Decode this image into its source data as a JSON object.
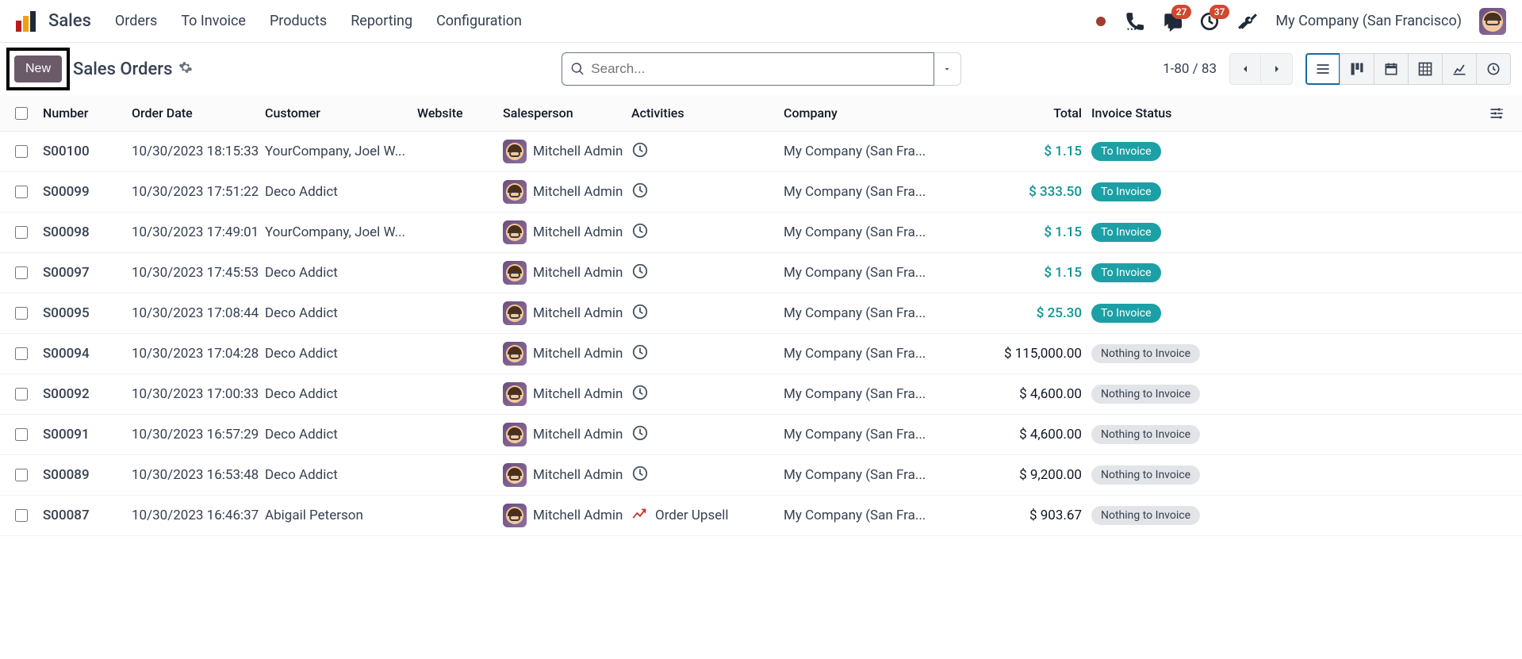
{
  "topbar": {
    "app_name": "Sales",
    "menu": [
      "Orders",
      "To Invoice",
      "Products",
      "Reporting",
      "Configuration"
    ],
    "chat_badge": "27",
    "activity_badge": "37",
    "company": "My Company (San Francisco)"
  },
  "controlbar": {
    "new_label": "New",
    "breadcrumb": "Sales Orders",
    "search_placeholder": "Search...",
    "pager_label": "1-80 / 83"
  },
  "table": {
    "columns": {
      "number": "Number",
      "order_date": "Order Date",
      "customer": "Customer",
      "website": "Website",
      "salesperson": "Salesperson",
      "activities": "Activities",
      "company": "Company",
      "total": "Total",
      "invoice_status": "Invoice Status"
    },
    "rows": [
      {
        "number": "S00100",
        "date": "10/30/2023 18:15:33",
        "customer": "YourCompany, Joel W...",
        "salesperson": "Mitchell Admin",
        "activity": "clock",
        "company": "My Company (San Fra...",
        "total": "$ 1.15",
        "total_style": "teal",
        "status": "To Invoice",
        "status_style": "toinvoice"
      },
      {
        "number": "S00099",
        "date": "10/30/2023 17:51:22",
        "customer": "Deco Addict",
        "salesperson": "Mitchell Admin",
        "activity": "clock",
        "company": "My Company (San Fra...",
        "total": "$ 333.50",
        "total_style": "teal",
        "status": "To Invoice",
        "status_style": "toinvoice"
      },
      {
        "number": "S00098",
        "date": "10/30/2023 17:49:01",
        "customer": "YourCompany, Joel W...",
        "salesperson": "Mitchell Admin",
        "activity": "clock",
        "company": "My Company (San Fra...",
        "total": "$ 1.15",
        "total_style": "teal",
        "status": "To Invoice",
        "status_style": "toinvoice"
      },
      {
        "number": "S00097",
        "date": "10/30/2023 17:45:53",
        "customer": "Deco Addict",
        "salesperson": "Mitchell Admin",
        "activity": "clock",
        "company": "My Company (San Fra...",
        "total": "$ 1.15",
        "total_style": "teal",
        "status": "To Invoice",
        "status_style": "toinvoice"
      },
      {
        "number": "S00095",
        "date": "10/30/2023 17:08:44",
        "customer": "Deco Addict",
        "salesperson": "Mitchell Admin",
        "activity": "clock",
        "company": "My Company (San Fra...",
        "total": "$ 25.30",
        "total_style": "teal",
        "status": "To Invoice",
        "status_style": "toinvoice"
      },
      {
        "number": "S00094",
        "date": "10/30/2023 17:04:28",
        "customer": "Deco Addict",
        "salesperson": "Mitchell Admin",
        "activity": "clock",
        "company": "My Company (San Fra...",
        "total": "$ 115,000.00",
        "total_style": "black",
        "status": "Nothing to Invoice",
        "status_style": "nothing"
      },
      {
        "number": "S00092",
        "date": "10/30/2023 17:00:33",
        "customer": "Deco Addict",
        "salesperson": "Mitchell Admin",
        "activity": "clock",
        "company": "My Company (San Fra...",
        "total": "$ 4,600.00",
        "total_style": "black",
        "status": "Nothing to Invoice",
        "status_style": "nothing"
      },
      {
        "number": "S00091",
        "date": "10/30/2023 16:57:29",
        "customer": "Deco Addict",
        "salesperson": "Mitchell Admin",
        "activity": "clock",
        "company": "My Company (San Fra...",
        "total": "$ 4,600.00",
        "total_style": "black",
        "status": "Nothing to Invoice",
        "status_style": "nothing"
      },
      {
        "number": "S00089",
        "date": "10/30/2023 16:53:48",
        "customer": "Deco Addict",
        "salesperson": "Mitchell Admin",
        "activity": "clock",
        "company": "My Company (San Fra...",
        "total": "$ 9,200.00",
        "total_style": "black",
        "status": "Nothing to Invoice",
        "status_style": "nothing"
      },
      {
        "number": "S00087",
        "date": "10/30/2023 16:46:37",
        "customer": "Abigail Peterson",
        "salesperson": "Mitchell Admin",
        "activity": "upsell",
        "activity_label": "Order Upsell",
        "company": "My Company (San Fra...",
        "total": "$ 903.67",
        "total_style": "black",
        "status": "Nothing to Invoice",
        "status_style": "nothing"
      }
    ]
  }
}
